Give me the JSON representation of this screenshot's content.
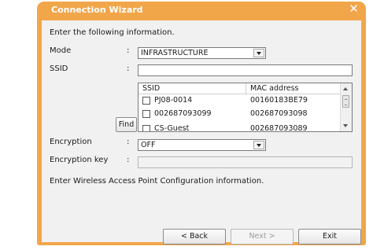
{
  "window": {
    "title": "Connection Wizard"
  },
  "intro_text": "Enter the following information.",
  "fields": {
    "mode": {
      "label": "Mode",
      "colon": ":",
      "value": "INFRASTRUCTURE"
    },
    "ssid": {
      "label": "SSID",
      "colon": ":",
      "value": ""
    },
    "encryption": {
      "label": "Encryption",
      "colon": ":",
      "value": "OFF"
    },
    "encryption_key": {
      "label": "Encryption key",
      "colon": ":",
      "value": ""
    }
  },
  "find_button": "Find",
  "ssid_list": {
    "columns": [
      "SSID",
      "MAC address"
    ],
    "rows": [
      {
        "ssid": "PJ08-0014",
        "mac": "00160183BE79",
        "checked": false
      },
      {
        "ssid": "002687093099",
        "mac": "002687093098",
        "checked": false
      },
      {
        "ssid": "CS-Guest",
        "mac": "002687093089",
        "checked": false
      }
    ]
  },
  "info_text": "Enter Wireless Access Point Configuration information.",
  "buttons": {
    "back": "< Back",
    "next": "Next >",
    "exit": "Exit"
  },
  "colors": {
    "title_bar": "#f2a64a",
    "client_bg": "#f1f1f1"
  }
}
